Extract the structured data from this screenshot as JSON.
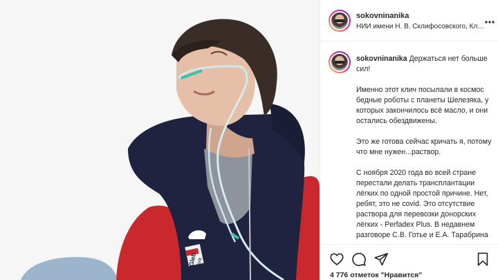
{
  "post": {
    "username": "sokovninanika",
    "location": "НИИ имени Н. В. Склифосовского, Клинико...",
    "caption_first": "Держаться нет больше сил!",
    "caption_paragraphs": [
      "Именно этот клич посылали в космос бедные роботы с планеты Шелезяка, у которых закончилось всё масло, и они остались обездвижены.",
      "Это же готова сейчас кричать я, потому что мне нужен...раствор.",
      "С ноября 2020 года во всей стране перестали делать трансплантации лёгких по одной простой причине. Нет, ребят, это не covid. Это отсутствие раствора для перевозки донорских лёгких - Perfadex Plus. В недавнем разговоре С.В. Готье и Е.А. Тарабрина"
    ],
    "likes_text": "4 776 отметок \"Нравится\""
  },
  "photo": {
    "jacket_patch_text": "Gleb",
    "jacket_patch_text2": "Sva"
  },
  "icons": {
    "more": "more-horizontal-icon",
    "like": "heart-icon",
    "comment": "comment-icon",
    "share": "paper-plane-icon",
    "save": "bookmark-icon"
  },
  "colors": {
    "text": "#262626",
    "divider": "#efefef",
    "jacket_navy": "#1f2340",
    "sleeve_red": "#c9282d"
  }
}
